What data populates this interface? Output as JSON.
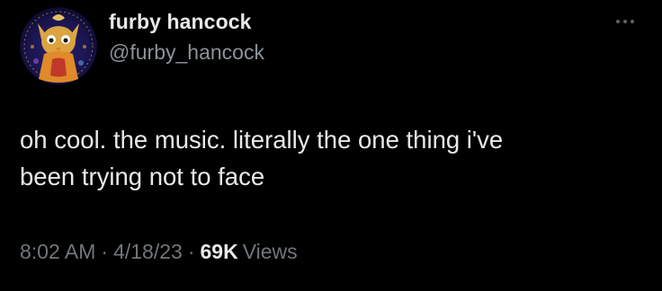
{
  "tweet": {
    "author": {
      "display_name": "furby hancock",
      "handle": "@furby_hancock"
    },
    "more_icon": "ellipsis-icon",
    "text_lines": [
      "oh cool. the music. literally the one thing i've",
      "been trying not to face"
    ],
    "meta": {
      "time": "8:02 AM",
      "separator": "·",
      "date": "4/18/23",
      "views_count": "69K",
      "views_label": "Views"
    }
  },
  "colors": {
    "background": "#000000",
    "primary_text": "#e7e9ea",
    "secondary_text": "#71767b",
    "avatar_ring": "#1a2a6c",
    "avatar_figure": "#d9a441"
  }
}
